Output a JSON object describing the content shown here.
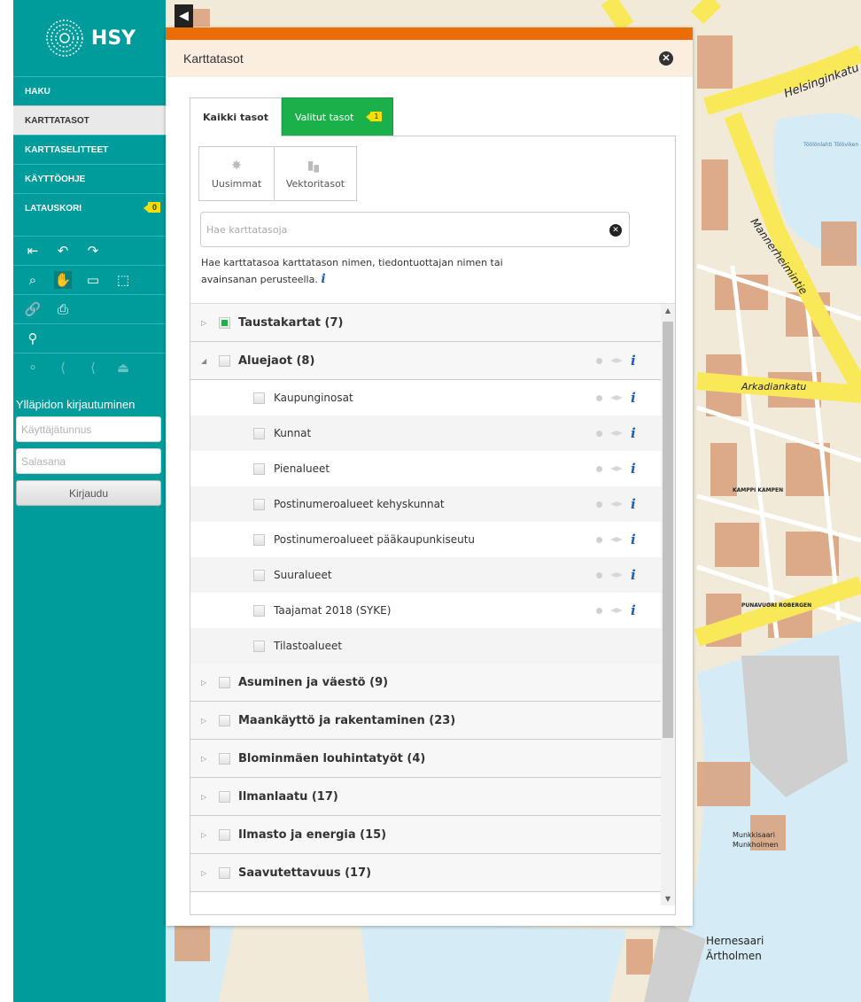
{
  "brand": {
    "logo_text": "HSY"
  },
  "sidebar": {
    "menu": [
      {
        "label": "HAKU"
      },
      {
        "label": "KARTTATASOT",
        "active": true
      },
      {
        "label": "KARTTASELITTEET"
      },
      {
        "label": "KÄYTTÖOHJE"
      },
      {
        "label": "LATAUSKORI",
        "badge": "0"
      }
    ],
    "login": {
      "title": "Ylläpidon kirjautuminen",
      "username_placeholder": "Käyttäjätunnus",
      "password_placeholder": "Salasana",
      "button": "Kirjaudu"
    }
  },
  "panel": {
    "title": "Karttatasot",
    "tabs": {
      "all": "Kaikki tasot",
      "selected": "Valitut tasot",
      "selected_badge": "1"
    },
    "filters": {
      "newest": "Uusimmat",
      "vector": "Vektoritasot"
    },
    "search": {
      "placeholder": "Hae karttatasoja",
      "help": "Hae karttatasoa karttatason nimen, tiedontuottajan nimen tai avainsanan perusteella."
    },
    "groups": [
      {
        "name": "Taustakartat (7)",
        "expanded": false,
        "partial": true
      },
      {
        "name": "Aluejaot (8)",
        "expanded": true,
        "partial": false,
        "layers": [
          {
            "name": "Kaupunginosat",
            "icons": true
          },
          {
            "name": "Kunnat",
            "icons": true
          },
          {
            "name": "Pienalueet",
            "icons": true
          },
          {
            "name": "Postinumeroalueet kehyskunnat",
            "icons": true
          },
          {
            "name": "Postinumeroalueet pääkaupunkiseutu",
            "icons": true
          },
          {
            "name": "Suuralueet",
            "icons": true
          },
          {
            "name": "Taajamat 2018 (SYKE)",
            "icons": true
          },
          {
            "name": "Tilastoalueet",
            "icons": false
          }
        ]
      },
      {
        "name": "Asuminen ja väestö (9)"
      },
      {
        "name": "Maankäyttö ja rakentaminen (23)"
      },
      {
        "name": "Blominmäen louhintatyöt (4)"
      },
      {
        "name": "Ilmanlaatu (17)"
      },
      {
        "name": "Ilmasto ja energia (15)"
      },
      {
        "name": "Saavutettavuus (17)"
      }
    ]
  },
  "map_labels": {
    "helsinginkatu": "Helsinginkatu",
    "mannerheimintie": "Mannerheimintie",
    "arkadiankatu": "Arkadiankatu",
    "hernesaari_fi": "Hernesaari",
    "hernesaari_sv": "Ärtholmen",
    "munkkisaari": "Munkkisaari",
    "munkholmen": "Munkholmen",
    "kamppi": "KAMPPI KAMPEN",
    "punavuori": "PUNAVUORI ROBERGEN",
    "toolonlahti": "Töölönlahti Tölöviken"
  },
  "colors": {
    "teal": "#009c9c",
    "orange": "#ec6c06",
    "green": "#1bb04a",
    "badge": "#f4e000"
  }
}
